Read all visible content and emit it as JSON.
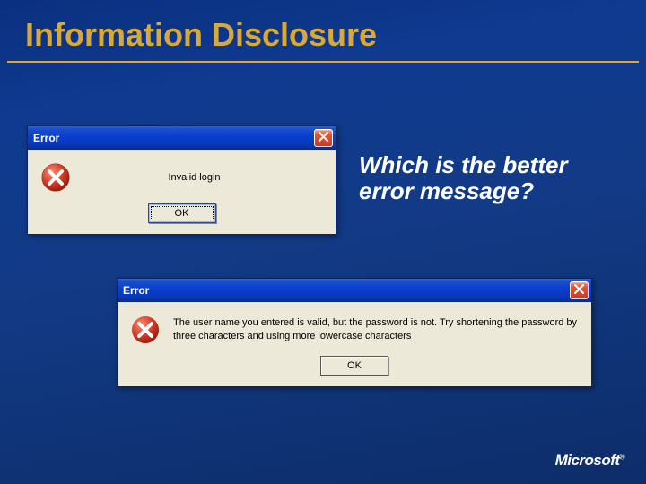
{
  "slide": {
    "title": "Information Disclosure",
    "question": "Which is the better error message?"
  },
  "dialog1": {
    "title": "Error",
    "message": "Invalid login",
    "ok_label": "OK"
  },
  "dialog2": {
    "title": "Error",
    "message": "The user name you entered is valid, but the password is not. Try shortening the password by three characters and using more lowercase characters",
    "ok_label": "OK"
  },
  "footer": {
    "brand": "Microsoft",
    "reg": "®"
  }
}
